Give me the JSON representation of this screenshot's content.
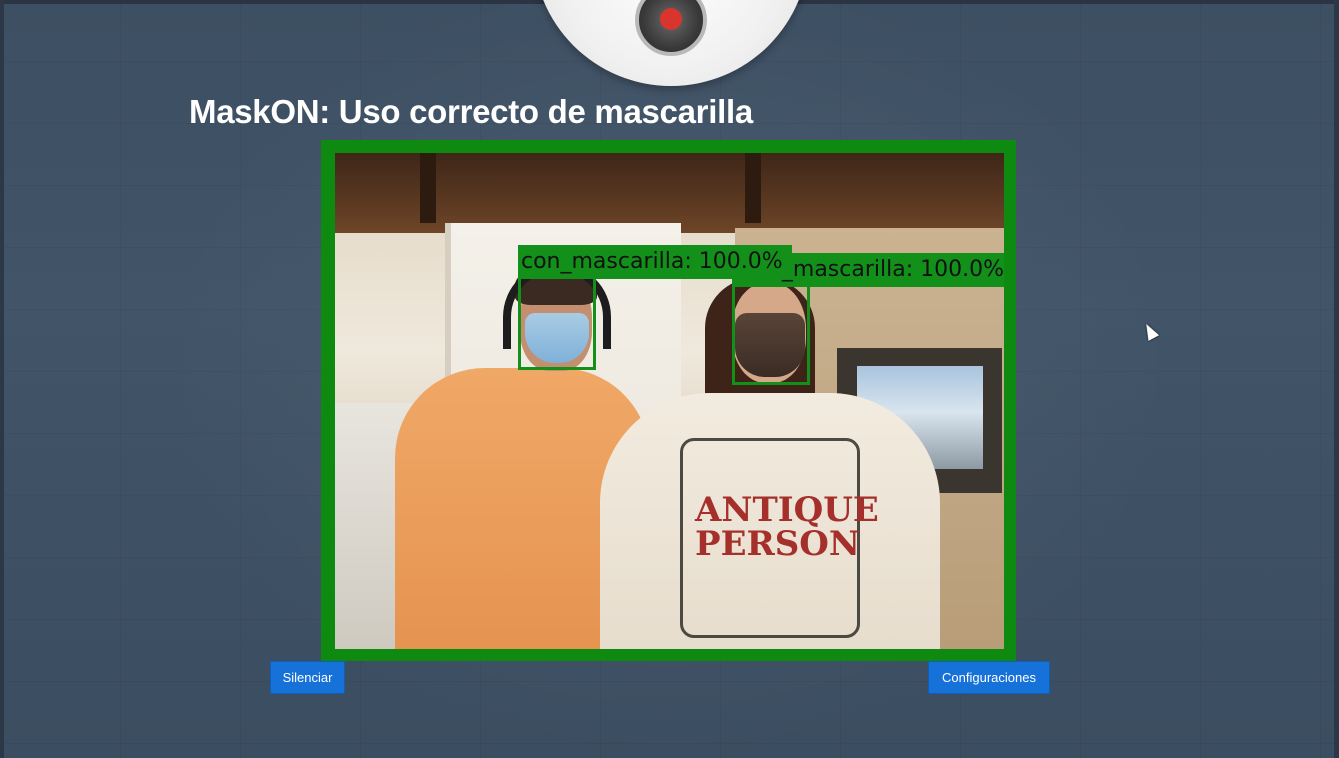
{
  "page": {
    "title": "MaskON: Uso correcto de mascarilla"
  },
  "video": {
    "detections": [
      {
        "label": "con_mascarilla: 100.0%",
        "color": "#12901a"
      },
      {
        "label": "con_mascarilla: 100.0%",
        "color": "#12901a"
      }
    ],
    "frame_color": "#0e8a10",
    "shirt_text": "ANTIQUE PERSON"
  },
  "buttons": {
    "mute_label": "Silenciar",
    "settings_label": "Configuraciones"
  },
  "colors": {
    "background": "#3f5266",
    "button": "#1672d8",
    "detection": "#12901a"
  },
  "icons": {
    "logo": "security-camera-icon",
    "cursor": "mouse-pointer-icon"
  }
}
